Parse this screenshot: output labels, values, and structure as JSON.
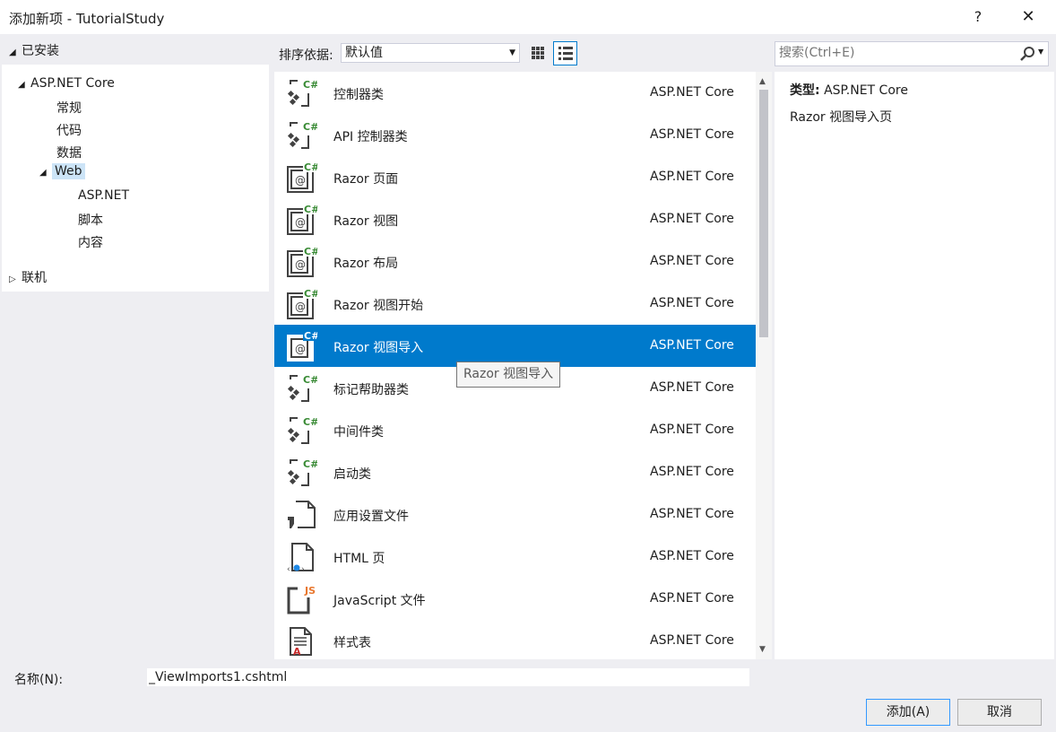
{
  "window": {
    "title": "添加新项 - TutorialStudy",
    "help_label": "?",
    "close_label": "✕"
  },
  "tree": {
    "installed_label": "已安装",
    "root": "ASP.NET Core",
    "children": [
      "常规",
      "代码",
      "数据"
    ],
    "web": "Web",
    "web_children": [
      "ASP.NET",
      "脚本",
      "内容"
    ],
    "online_label": "联机"
  },
  "sort": {
    "label": "排序依据:",
    "value": "默认值"
  },
  "search": {
    "placeholder": "搜索(Ctrl+E)"
  },
  "items": [
    {
      "name": "控制器类",
      "category": "ASP.NET Core",
      "icon": "csharp-class-icon"
    },
    {
      "name": "API 控制器类",
      "category": "ASP.NET Core",
      "icon": "csharp-class-icon"
    },
    {
      "name": "Razor 页面",
      "category": "ASP.NET Core",
      "icon": "razor-icon"
    },
    {
      "name": "Razor 视图",
      "category": "ASP.NET Core",
      "icon": "razor-icon"
    },
    {
      "name": "Razor 布局",
      "category": "ASP.NET Core",
      "icon": "razor-icon"
    },
    {
      "name": "Razor 视图开始",
      "category": "ASP.NET Core",
      "icon": "razor-icon"
    },
    {
      "name": "Razor 视图导入",
      "category": "ASP.NET Core",
      "icon": "razor-icon",
      "selected": true
    },
    {
      "name": "标记帮助器类",
      "category": "ASP.NET Core",
      "icon": "csharp-class-icon"
    },
    {
      "name": "中间件类",
      "category": "ASP.NET Core",
      "icon": "csharp-class-icon"
    },
    {
      "name": "启动类",
      "category": "ASP.NET Core",
      "icon": "csharp-class-icon"
    },
    {
      "name": "应用设置文件",
      "category": "ASP.NET Core",
      "icon": "settings-file-icon"
    },
    {
      "name": "HTML 页",
      "category": "ASP.NET Core",
      "icon": "html-file-icon"
    },
    {
      "name": "JavaScript 文件",
      "category": "ASP.NET Core",
      "icon": "javascript-file-icon"
    },
    {
      "name": "样式表",
      "category": "ASP.NET Core",
      "icon": "stylesheet-icon"
    }
  ],
  "tooltip": "Razor 视图导入",
  "detail": {
    "type_label": "类型:",
    "type_value": "ASP.NET Core",
    "description": "Razor 视图导入页"
  },
  "name_field": {
    "label": "名称(N):",
    "value": "_ViewImports1.cshtml"
  },
  "buttons": {
    "add": "添加(A)",
    "cancel": "取消"
  },
  "colors": {
    "accent": "#007acc",
    "panel_bg": "#eeeef2",
    "csharp_green": "#388a34"
  }
}
